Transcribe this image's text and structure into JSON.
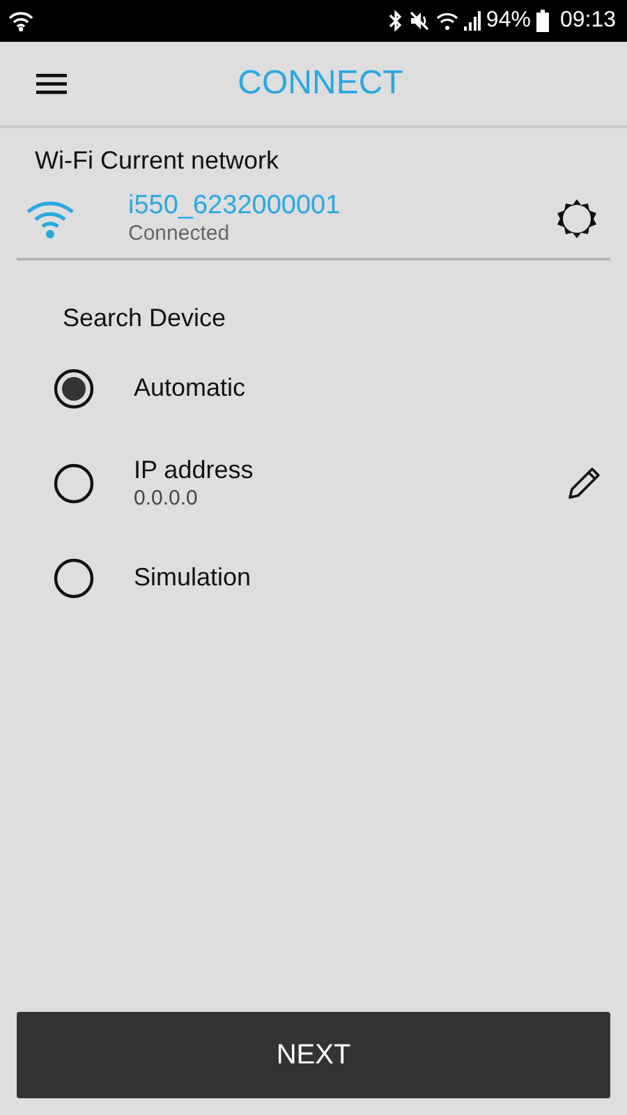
{
  "status_bar": {
    "battery_text": "94%",
    "time": "09:13"
  },
  "app_bar": {
    "title": "CONNECT"
  },
  "wifi": {
    "heading": "Wi-Fi Current network",
    "network": "i550_6232000001",
    "status": "Connected"
  },
  "search": {
    "heading": "Search Device",
    "options": [
      {
        "label": "Automatic",
        "selected": true,
        "kind": "plain"
      },
      {
        "label": "IP address",
        "detail": "0.0.0.0",
        "selected": false,
        "kind": "editable"
      },
      {
        "label": "Simulation",
        "selected": false,
        "kind": "plain"
      }
    ]
  },
  "next_button": {
    "label": "NEXT"
  }
}
